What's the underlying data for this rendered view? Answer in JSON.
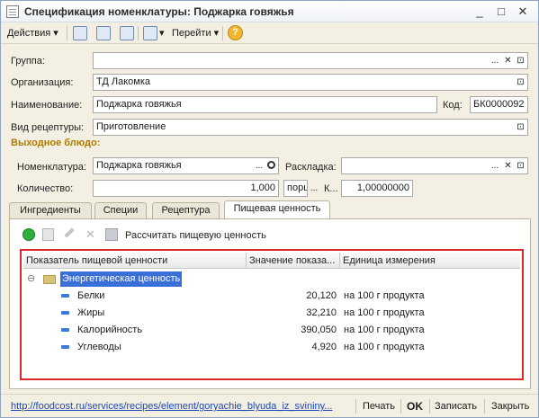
{
  "window": {
    "title": "Спецификация номенклатуры: Поджарка говяжья",
    "minimize_glyph": "_",
    "maximize_glyph": "□",
    "close_glyph": "✕"
  },
  "toolbar": {
    "actions_label": "Действия",
    "actions_arrow": "▾",
    "goto_label": "Перейти",
    "goto_arrow": "▾",
    "help_glyph": "?"
  },
  "form": {
    "group_label": "Группа:",
    "group_value": "",
    "org_label": "Организация:",
    "org_value": "ТД Лакомка",
    "name_label": "Наименование:",
    "name_value": "Поджарка говяжья",
    "code_label": "Код:",
    "code_value": "БК0000092",
    "recipe_type_label": "Вид рецептуры:",
    "recipe_type_value": "Приготовление",
    "output_dish_heading": "Выходное блюдо:",
    "nomenclature_label": "Номенклатура:",
    "nomenclature_value": "Поджарка говяжья",
    "layout_label": "Раскладка:",
    "layout_value": "",
    "quantity_label": "Количество:",
    "quantity_value": "1,000",
    "unit_value": "порц",
    "coef_label": "К...",
    "coef_value": "1,00000000",
    "select_glyph": "...",
    "clear_glyph": "✕",
    "open_glyph": "⊡"
  },
  "tabs": [
    {
      "label": "Ингредиенты"
    },
    {
      "label": "Специи"
    },
    {
      "label": "Рецептура"
    },
    {
      "label": "Пищевая ценность"
    }
  ],
  "panel": {
    "calc_label": "Рассчитать пищевую ценность"
  },
  "grid": {
    "columns": [
      "Показатель пищевой ценности",
      "Значение показа...",
      "Единица измерения"
    ],
    "group": {
      "name": "Энергетическая ценность",
      "toggle": "⊖"
    },
    "rows": [
      {
        "name": "Белки",
        "value": "20,120",
        "unit": "на 100 г продукта"
      },
      {
        "name": "Жиры",
        "value": "32,210",
        "unit": "на 100 г продукта"
      },
      {
        "name": "Калорийность",
        "value": "390,050",
        "unit": "на 100 г продукта"
      },
      {
        "name": "Углеводы",
        "value": "4,920",
        "unit": "на 100 г продукта"
      }
    ]
  },
  "status": {
    "link": "http://foodcost.ru/services/recipes/element/goryachie_blyuda_iz_svininy...",
    "print_label": "Печать",
    "ok_label": "OK",
    "save_label": "Записать",
    "close_label": "Закрыть"
  },
  "colors": {
    "accent": "#b07a00",
    "highlight": "#d92a2a",
    "selection": "#3a6fd8",
    "link": "#1a46b8"
  }
}
